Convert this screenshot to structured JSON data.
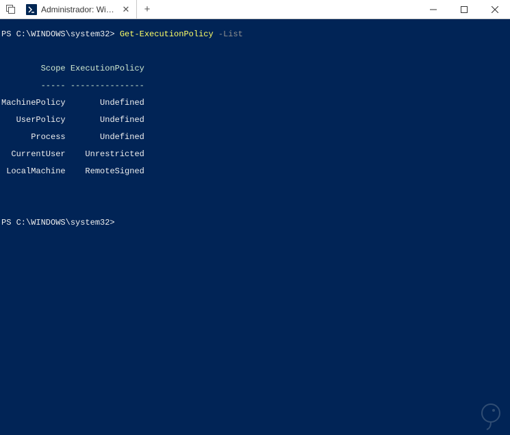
{
  "tab": {
    "title": "Administrador: Window"
  },
  "terminal": {
    "prompt": "PS C:\\WINDOWS\\system32>",
    "command": "Get-ExecutionPolicy",
    "argument": "-List",
    "headers": {
      "scope": "Scope",
      "policy": "ExecutionPolicy"
    },
    "divider": {
      "scope": "-----",
      "policy": "---------------"
    },
    "rows": [
      {
        "scope": "MachinePolicy",
        "policy": "Undefined"
      },
      {
        "scope": "UserPolicy",
        "policy": "Undefined"
      },
      {
        "scope": "Process",
        "policy": "Undefined"
      },
      {
        "scope": "CurrentUser",
        "policy": "Unrestricted"
      },
      {
        "scope": "LocalMachine",
        "policy": "RemoteSigned"
      }
    ]
  }
}
